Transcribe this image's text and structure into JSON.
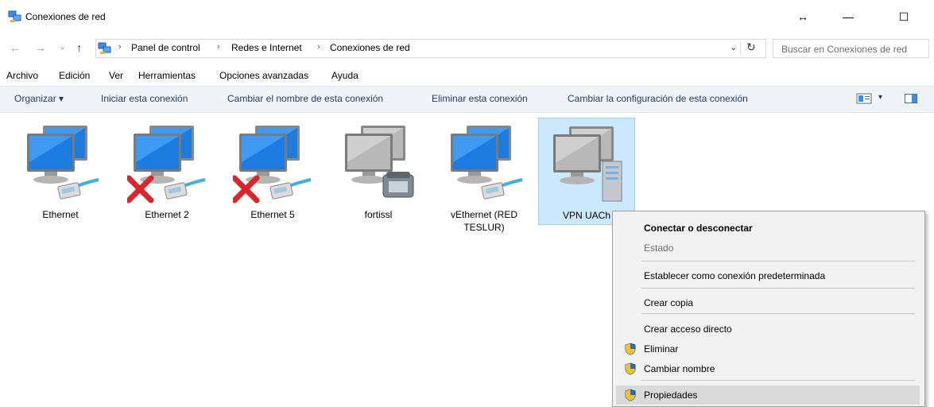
{
  "window": {
    "title": "Conexiones de red",
    "restore_glyph": "↔",
    "minimize_glyph": "—",
    "maximize_glyph": "☐"
  },
  "nav": {
    "back_glyph": "←",
    "forward_glyph": "→",
    "recent_glyph": "⌄",
    "up_glyph": "↑",
    "breadcrumb_sep": "›",
    "breadcrumbs": [
      "Panel de control",
      "Redes e Internet",
      "Conexiones de red"
    ],
    "dropdown_glyph": "⌄",
    "refresh_glyph": "↻"
  },
  "search": {
    "placeholder": "Buscar en Conexiones de red"
  },
  "menubar": {
    "items": [
      "Archivo",
      "Edición",
      "Ver",
      "Herramientas",
      "Opciones avanzadas",
      "Ayuda"
    ]
  },
  "commandbar": {
    "organize": "Organizar ▾",
    "commands": [
      "Iniciar esta conexión",
      "Cambiar el nombre de esta conexión",
      "Eliminar esta conexión",
      "Cambiar la configuración de esta conexión"
    ],
    "view_dropdown_glyph": "▾"
  },
  "connections": [
    {
      "label": "Ethernet",
      "icon": "network-adapter-icon",
      "disconnected": false
    },
    {
      "label": "Ethernet 2",
      "icon": "network-adapter-icon",
      "disconnected": true
    },
    {
      "label": "Ethernet 5",
      "icon": "network-adapter-icon",
      "disconnected": true
    },
    {
      "label": "fortissl",
      "icon": "dialup-modem-icon",
      "disconnected": false
    },
    {
      "label": "vEthernet (RED TESLUR)",
      "icon": "network-adapter-icon",
      "disconnected": false
    },
    {
      "label": "VPN UACh",
      "icon": "vpn-server-icon",
      "disconnected": false,
      "selected": true
    }
  ],
  "context_menu": {
    "items": [
      {
        "label": "Conectar o desconectar",
        "bold": true
      },
      {
        "label": "Estado",
        "disabled": true
      },
      {
        "label": "Establecer como conexión predeterminada"
      },
      {
        "label": "Crear copia"
      },
      {
        "label": "Crear acceso directo"
      },
      {
        "label": "Eliminar",
        "shield": true
      },
      {
        "label": "Cambiar nombre",
        "shield": true
      },
      {
        "label": "Propiedades",
        "shield": true,
        "highlighted": true
      }
    ]
  },
  "colors": {
    "accent": "#0078d7",
    "selection_bg": "#cce8ff",
    "commandbar_bg": "#f0f4f9",
    "menu_bg": "#f2f2f2",
    "error_red": "#d9262c"
  }
}
